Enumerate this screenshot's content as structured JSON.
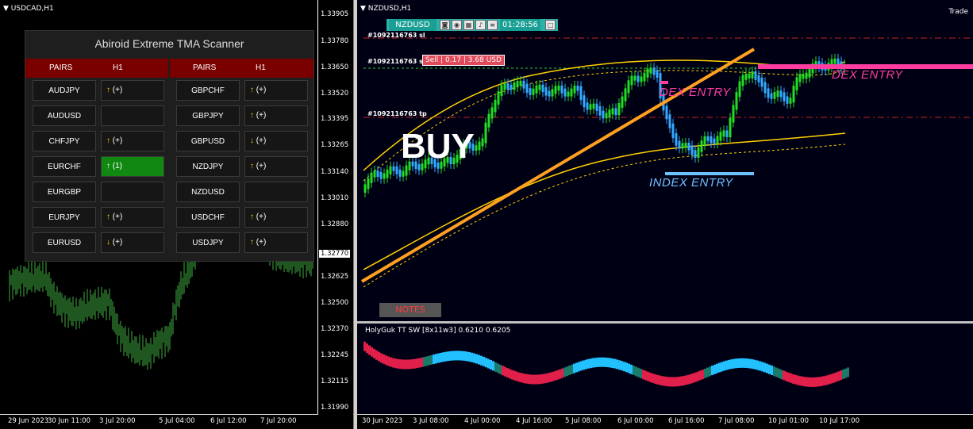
{
  "left_chart": {
    "title": "USDCAD,H1",
    "prices": [
      "1.33905",
      "1.33780",
      "1.33650",
      "1.33520",
      "1.33395",
      "1.33265",
      "1.33140",
      "1.33010",
      "1.32880",
      "1.32625",
      "1.32500",
      "1.32370",
      "1.32245",
      "1.32115",
      "1.31990"
    ],
    "current_price": "1.32770",
    "times": [
      "29 Jun 2023",
      "30 Jun 11:00",
      "3 Jul 20:00",
      "5 Jul 04:00",
      "6 Jul 12:00",
      "7 Jul 20:00"
    ],
    "candle_color": "#3fae3f"
  },
  "scanner": {
    "title": "Abiroid Extreme TMA Scanner",
    "header_pairs": "PAIRS",
    "header_tf": "H1",
    "left_rows": [
      {
        "pair": "AUDJPY",
        "arrow": "up",
        "signal": "(+)"
      },
      {
        "pair": "AUDUSD",
        "arrow": "",
        "signal": ""
      },
      {
        "pair": "CHFJPY",
        "arrow": "up",
        "signal": "(+)"
      },
      {
        "pair": "EURCHF",
        "arrow": "up",
        "signal": "(1)",
        "highlight": true
      },
      {
        "pair": "EURGBP",
        "arrow": "",
        "signal": ""
      },
      {
        "pair": "EURJPY",
        "arrow": "up",
        "signal": "(+)"
      },
      {
        "pair": "EURUSD",
        "arrow": "down",
        "signal": "(+)"
      }
    ],
    "right_rows": [
      {
        "pair": "GBPCHF",
        "arrow": "up",
        "signal": "(+)"
      },
      {
        "pair": "GBPJPY",
        "arrow": "up",
        "signal": "(+)"
      },
      {
        "pair": "GBPUSD",
        "arrow": "down",
        "signal": "(+)"
      },
      {
        "pair": "NZDJPY",
        "arrow": "up",
        "signal": "(+)"
      },
      {
        "pair": "NZDUSD",
        "arrow": "",
        "signal": ""
      },
      {
        "pair": "USDCHF",
        "arrow": "up",
        "signal": "(+)"
      },
      {
        "pair": "USDJPY",
        "arrow": "up",
        "signal": "(+)"
      }
    ],
    "colors": {
      "header": "#7a0000",
      "highlight": "#118811",
      "arrow": "#ffd800"
    }
  },
  "right_chart": {
    "title": "NZDUSD,H1",
    "toolbar_pair": "NZDUSD",
    "toolbar_time": "01:28:56",
    "trade_label": "Trade",
    "sl_label": "#1092116763 sl",
    "open_label": "#1092116763 s",
    "tp_label": "#1092116763 tp",
    "sell_tag": "Sell | 0.17 | 3.68 USD",
    "buy_text": "BUY",
    "dex_entry_1": "DEX ENTRY",
    "dex_entry_2": "DEX ENTRY",
    "index_entry": "INDEX ENTRY",
    "notes": "NOTES",
    "subwindow_title": "HolyGuk TT SW [8x11w3]  0.6210 0.6205",
    "times": [
      "30 Jun 2023",
      "3 Jul 08:00",
      "4 Jul 00:00",
      "4 Jul 16:00",
      "5 Jul 08:00",
      "6 Jul 00:00",
      "6 Jul 16:00",
      "7 Jul 08:00",
      "10 Jul 01:00",
      "10 Jul 17:00"
    ],
    "colors": {
      "bull": "#22dd22",
      "bear": "#33aaff",
      "trendline": "#ffa020",
      "band": "#ffd200",
      "dex": "#ff3ca0",
      "index": "#6ec0ff"
    }
  }
}
